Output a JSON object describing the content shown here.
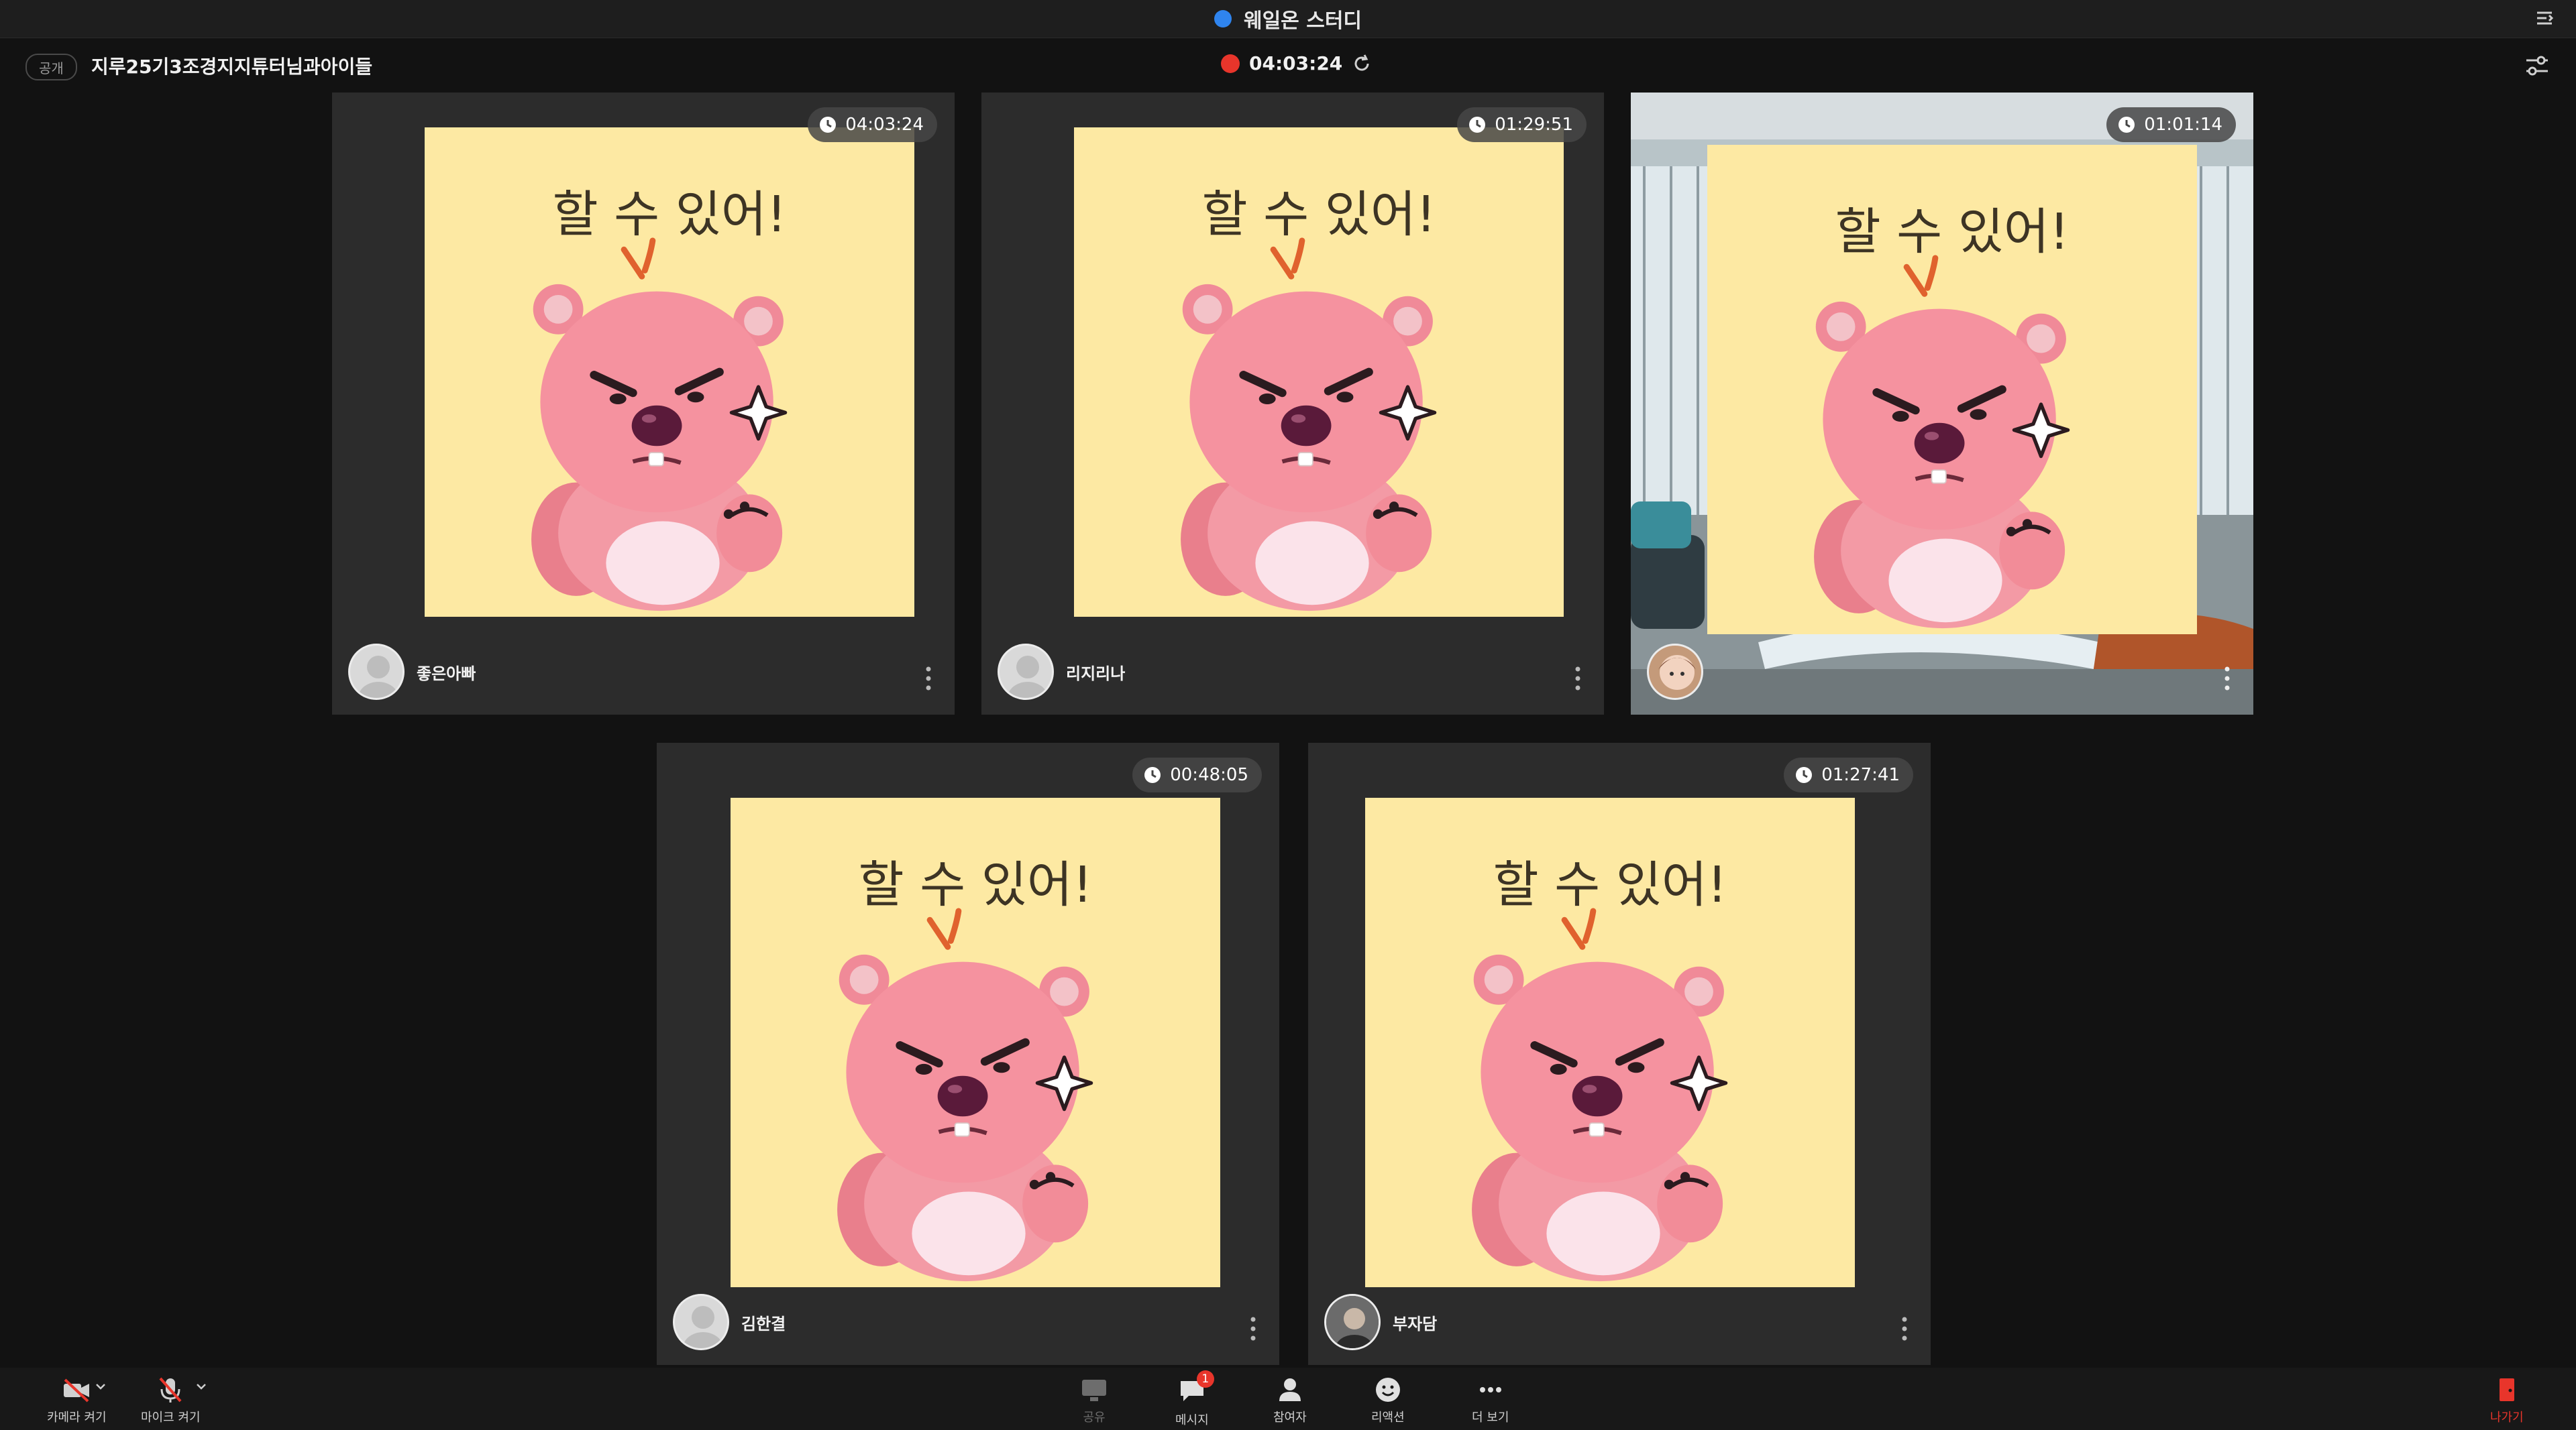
{
  "window": {
    "title": "웨일온 스터디"
  },
  "header": {
    "visibility": "공개",
    "room_title": "지루25기3조경지지튜터님과아이들",
    "recording_time": "04:03:24"
  },
  "participants": [
    {
      "name": "좋은아빠",
      "timer": "04:03:24"
    },
    {
      "name": "리지리나",
      "timer": "01:29:51"
    },
    {
      "name": "",
      "timer": "01:01:14"
    },
    {
      "name": "김한결",
      "timer": "00:48:05"
    },
    {
      "name": "부자담",
      "timer": "01:27:41"
    }
  ],
  "sticker": {
    "text": "할 수 있어!",
    "icon": "angry-beaver-sticker"
  },
  "toolbar": {
    "camera_label": "카메라 켜기",
    "mic_label": "마이크 켜기",
    "share_label": "공유",
    "message_label": "메시지",
    "message_badge": "1",
    "participants_label": "참여자",
    "reaction_label": "리액션",
    "more_label": "더 보기",
    "leave_label": "나가기"
  },
  "colors": {
    "background": "#121212",
    "tile": "#2c2c2c",
    "sticker_bg": "#fde9a3",
    "beaver_pink": "#f28c98",
    "record_red": "#e8352b",
    "accent_blue": "#2f84ee"
  }
}
